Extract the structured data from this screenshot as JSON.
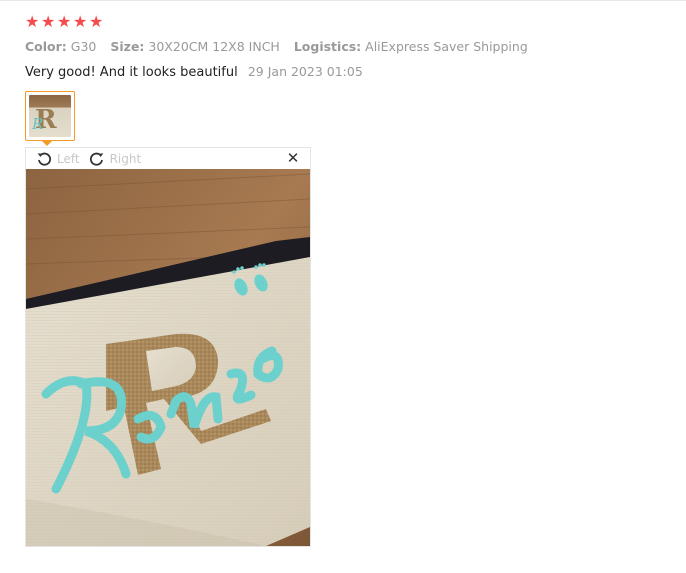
{
  "rating": {
    "stars": 5,
    "star_color": "#f44b4b",
    "star_glyph": "★"
  },
  "attributes": [
    {
      "key": "Color:",
      "value": "G30"
    },
    {
      "key": "Size:",
      "value": "30X20CM 12X8 INCH"
    },
    {
      "key": "Logistics:",
      "value": "AliExpress Saver Shipping"
    }
  ],
  "review": {
    "text": "Very good! And it looks beautiful",
    "date": "29 Jan 2023 01:05"
  },
  "viewer": {
    "rotate_left_label": "Left",
    "rotate_right_label": "Right",
    "close_glyph": "✕",
    "photo_text": "Romeo",
    "photo_letter": "R"
  },
  "colors": {
    "accent_thumb_border": "#f39a29",
    "photo_script": "#6cd0cc",
    "glitter_letter": "#a8875a"
  }
}
